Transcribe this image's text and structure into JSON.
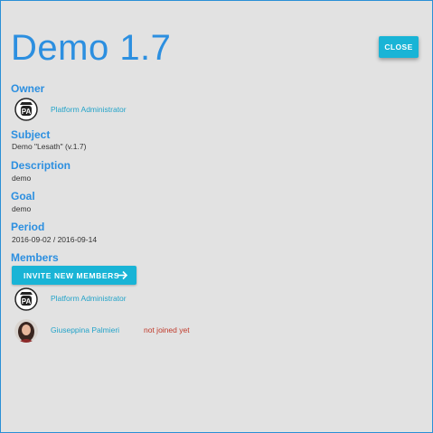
{
  "dialog": {
    "title": "Demo 1.7",
    "close_label": "CLOSE"
  },
  "owner": {
    "heading": "Owner",
    "name": "Platform Administrator",
    "avatar_text": "PA",
    "avatar_icon": "pa-badge-icon"
  },
  "subject": {
    "heading": "Subject",
    "value": "Demo \"Lesath\" (v.1.7)"
  },
  "description": {
    "heading": "Description",
    "value": "demo"
  },
  "goal": {
    "heading": "Goal",
    "value": "demo"
  },
  "period": {
    "heading": "Period",
    "value": "2016-09-02 / 2016-09-14"
  },
  "members": {
    "heading": "Members",
    "invite_label": "INVITE NEW MEMBERS",
    "items": [
      {
        "name": "Platform Administrator",
        "avatar_text": "PA",
        "status": ""
      },
      {
        "name": "Giuseppina Palmieri",
        "avatar_text": "",
        "status": "not joined yet"
      }
    ]
  },
  "colors": {
    "accent": "#2c8fe0",
    "button": "#19b4d6",
    "link": "#22a3c9",
    "warning": "#c03a2b",
    "background": "#e2e2e2"
  }
}
